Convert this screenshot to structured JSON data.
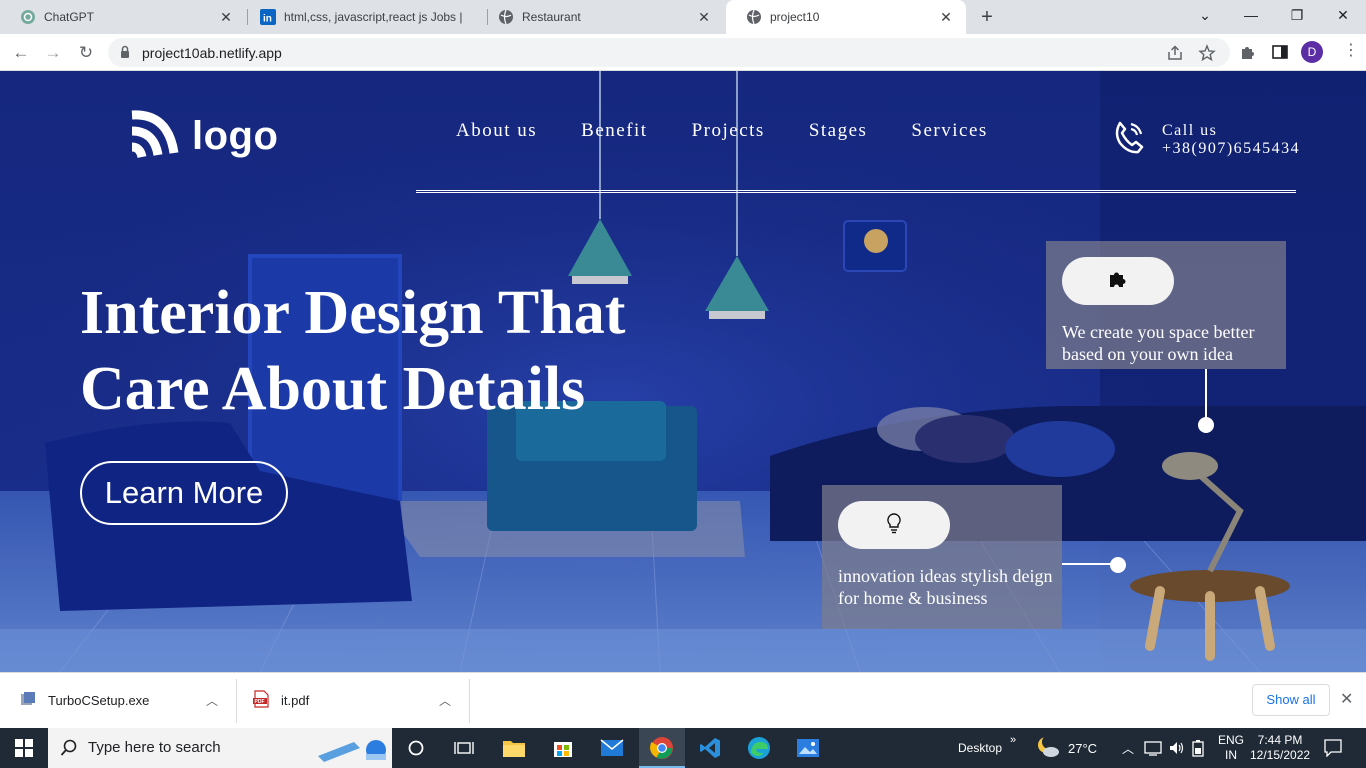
{
  "browser": {
    "tabs": [
      {
        "title": "ChatGPT",
        "favicon": "chatgpt-icon"
      },
      {
        "title": "html,css, javascript,react js Jobs |",
        "favicon": "linkedin-icon"
      },
      {
        "title": "Restaurant",
        "favicon": "globe-icon"
      },
      {
        "title": "project10",
        "favicon": "globe-icon",
        "active": true
      }
    ],
    "url": "project10ab.netlify.app",
    "profile_initial": "D"
  },
  "site": {
    "logo_text": "logo",
    "nav": [
      "About us",
      "Benefit",
      "Projects",
      "Stages",
      "Services"
    ],
    "call_label": "Call us",
    "call_number": "+38(907)6545434",
    "headline_line1": "Interior Design That",
    "headline_line2": "Care About Details",
    "cta": "Learn More",
    "card1_text": "We create you space better based on your own idea",
    "card2_line1": "innovation ideas stylish deign",
    "card2_line2": "for home & business"
  },
  "downloads": {
    "items": [
      {
        "name": "TurboCSetup.exe",
        "icon": "installer-icon"
      },
      {
        "name": "it.pdf",
        "icon": "pdf-icon"
      }
    ],
    "show_all": "Show all"
  },
  "taskbar": {
    "search_placeholder": "Type here to search",
    "desktop_label": "Desktop",
    "weather": "27°C",
    "lang_line1": "ENG",
    "lang_line2": "IN",
    "time": "7:44 PM",
    "date": "12/15/2022"
  },
  "colors": {
    "hero_blue": "#152a85",
    "card_gray": "#7d7d8c",
    "profile_purple": "#5b2ea6",
    "link_blue": "#1a73e8",
    "taskbar": "#1f2a36"
  }
}
